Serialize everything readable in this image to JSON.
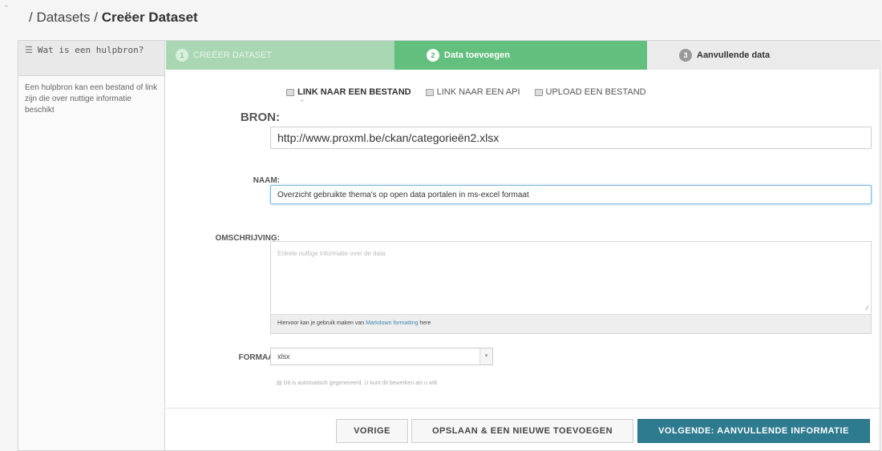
{
  "corner_mark": "˜",
  "breadcrumb": {
    "prefix": "/ Datasets / ",
    "current": "Creëer Dataset"
  },
  "sidebar": {
    "title": "Wat is een hulpbron?",
    "text": "Een hulpbron kan een bestand of link zijn die over nuttige informatie beschikt"
  },
  "steps": [
    {
      "num": "1",
      "label": "CREËER DATASET"
    },
    {
      "num": "2",
      "label": "Data toevoegen"
    },
    {
      "num": "3",
      "label": "Aanvullende data"
    }
  ],
  "source_tabs": [
    {
      "label": "LINK NAAR EEN BESTAND",
      "icon": "file-icon"
    },
    {
      "label": "LINK NAAR EEN API",
      "icon": "api-icon"
    },
    {
      "label": "UPLOAD EEN BESTAND",
      "icon": "upload-icon"
    }
  ],
  "form": {
    "bron_label": "BRON:",
    "bron_value": "http://www.proxml.be/ckan/categorieën2.xlsx",
    "naam_label": "NAAM:",
    "naam_value": "Overzicht gebruikte thema's op open data portalen in ms-excel formaat",
    "omschrijving_label": "OMSCHRIJVING:",
    "omschrijving_placeholder": "Enkele nuttige informatie over de data",
    "markdown_prefix": "Hiervoor kan je gebruik maken van ",
    "markdown_link": "Markdown formatting",
    "markdown_suffix": " here",
    "formaat_label": "FORMAAT:",
    "formaat_value": "xlsx",
    "formaat_note": "Dit is automatisch gegenereerd. U kunt dit bewerken als u wilt"
  },
  "buttons": {
    "prev": "VORIGE",
    "save_new": "OPSLAAN & EEN NIEUWE TOEVOEGEN",
    "next": "VOLGENDE: AANVULLENDE INFORMATIE"
  },
  "colors": {
    "step_done": "#a9d7b3",
    "step_active": "#62bf7d",
    "primary_button": "#2e7a8f"
  }
}
